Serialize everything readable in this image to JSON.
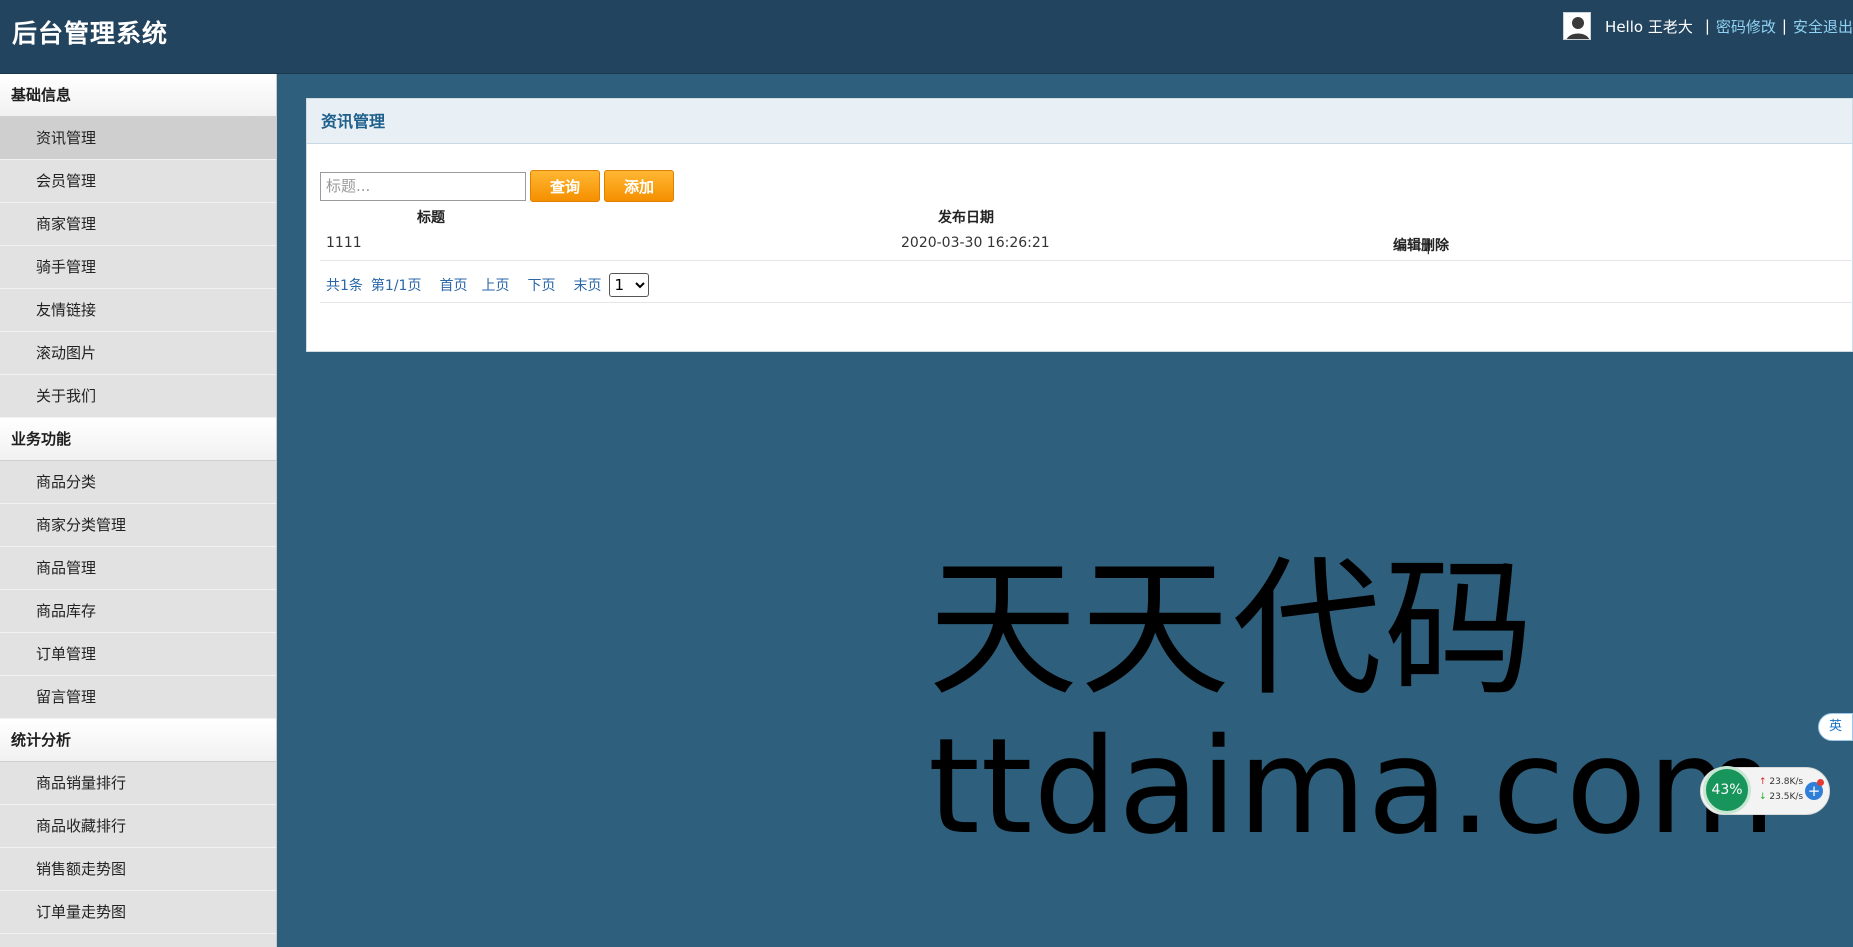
{
  "header": {
    "app_title": "后台管理系统",
    "hello": "Hello 王老大",
    "sep": "|",
    "change_password": "密码修改",
    "logout": "安全退出"
  },
  "sidebar": {
    "groups": [
      {
        "title": "基础信息",
        "items": [
          "资讯管理",
          "会员管理",
          "商家管理",
          "骑手管理",
          "友情链接",
          "滚动图片",
          "关于我们"
        ]
      },
      {
        "title": "业务功能",
        "items": [
          "商品分类",
          "商家分类管理",
          "商品管理",
          "商品库存",
          "订单管理",
          "留言管理"
        ]
      },
      {
        "title": "统计分析",
        "items": [
          "商品销量排行",
          "商品收藏排行",
          "销售额走势图",
          "订单量走势图"
        ]
      }
    ],
    "active_item": "资讯管理"
  },
  "panel": {
    "title": "资讯管理",
    "search_placeholder": "标题...",
    "search_button": "查询",
    "add_button": "添加",
    "columns": {
      "title": "标题",
      "date": "发布日期"
    },
    "rows": [
      {
        "title": "1111",
        "date": "2020-03-30 16:26:21",
        "edit": "编辑",
        "delete": "删除"
      }
    ],
    "pager": {
      "total": "共1条",
      "page": "第1/1页",
      "first": "首页",
      "prev": "上页",
      "next": "下页",
      "last": "末页",
      "selected_page": "1"
    }
  },
  "watermark": {
    "line1": "天天代码",
    "line2": "ttdaima.com"
  },
  "overlays": {
    "ime_label": "英",
    "net_percent": "43%",
    "upload_speed": "23.8K/s",
    "download_speed": "23.5K/s",
    "plus": "+"
  }
}
